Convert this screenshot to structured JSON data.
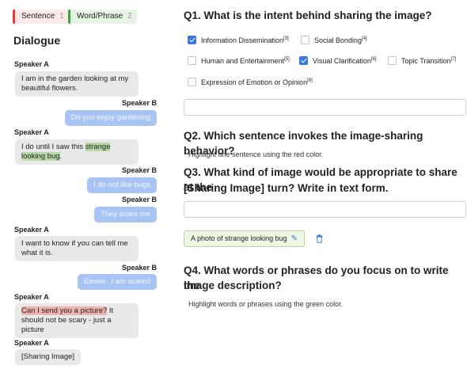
{
  "tags": {
    "sentence": {
      "label": "Sentence",
      "count": "1",
      "color": "#e23b3b"
    },
    "word": {
      "label": "Word/Phrase",
      "count": "2",
      "color": "#3aa53a"
    }
  },
  "dialogue": {
    "title": "Dialogue",
    "turns": [
      {
        "speaker": "Speaker A",
        "text": "I am in the garden looking at my beautiful flowers."
      },
      {
        "speaker": "Speaker B",
        "text": "Do you enjoy gardening"
      },
      {
        "speaker": "Speaker A",
        "text_before": "I do until I saw this ",
        "highlight": "strange looking bug",
        "text_after": "."
      },
      {
        "speaker": "Speaker B",
        "text": "I do not like bugs"
      },
      {
        "speaker": "Speaker B",
        "text": "They scare me"
      },
      {
        "speaker": "Speaker A",
        "text": "I want to know if you can tell me what it is."
      },
      {
        "speaker": "Speaker B",
        "text": "Ewww...I am scared"
      },
      {
        "speaker": "Speaker A",
        "highlight": "Can I send you a picture?",
        "text_after": " It should not be scary - just a picture"
      },
      {
        "speaker": "Speaker A",
        "text": "[Sharing Image]"
      }
    ]
  },
  "q1": {
    "title": "Q1. What is the intent behind sharing the image?",
    "options": [
      {
        "label": "Information Dissemination",
        "ref": "[3]",
        "checked": true
      },
      {
        "label": "Social Bonding",
        "ref": "[4]",
        "checked": false
      },
      {
        "label": "Human and Entertainment",
        "ref": "[5]",
        "checked": false
      },
      {
        "label": "Visual Clarification",
        "ref": "[6]",
        "checked": true
      },
      {
        "label": "Topic Transition",
        "ref": "[7]",
        "checked": false
      },
      {
        "label": "Expression of Emotion or Opinion",
        "ref": "[8]",
        "checked": false
      }
    ],
    "other_value": ""
  },
  "q2": {
    "title": "Q2. Which sentence invokes the image-sharing behavior?",
    "hint": "Highlight one sentence using the red color."
  },
  "q3": {
    "title_line1": "Q3. What kind of image would be appropriate to share at the",
    "title_line2": "[Sharing Image] turn? Write in text form.",
    "input_value": "",
    "answer": "A photo of strange looking bug"
  },
  "q4": {
    "title_line1": "Q4. What words or phrases do you focus on to write the",
    "title_line2": "image description?",
    "hint": "Highlight words or phrases using the green color."
  },
  "colors": {
    "accent": "#3a78e0",
    "bubble_a": "#e9e9ea",
    "bubble_b": "#a8c4f5",
    "highlight_green": "#b7d9a8",
    "highlight_red": "#f0b4b0"
  }
}
